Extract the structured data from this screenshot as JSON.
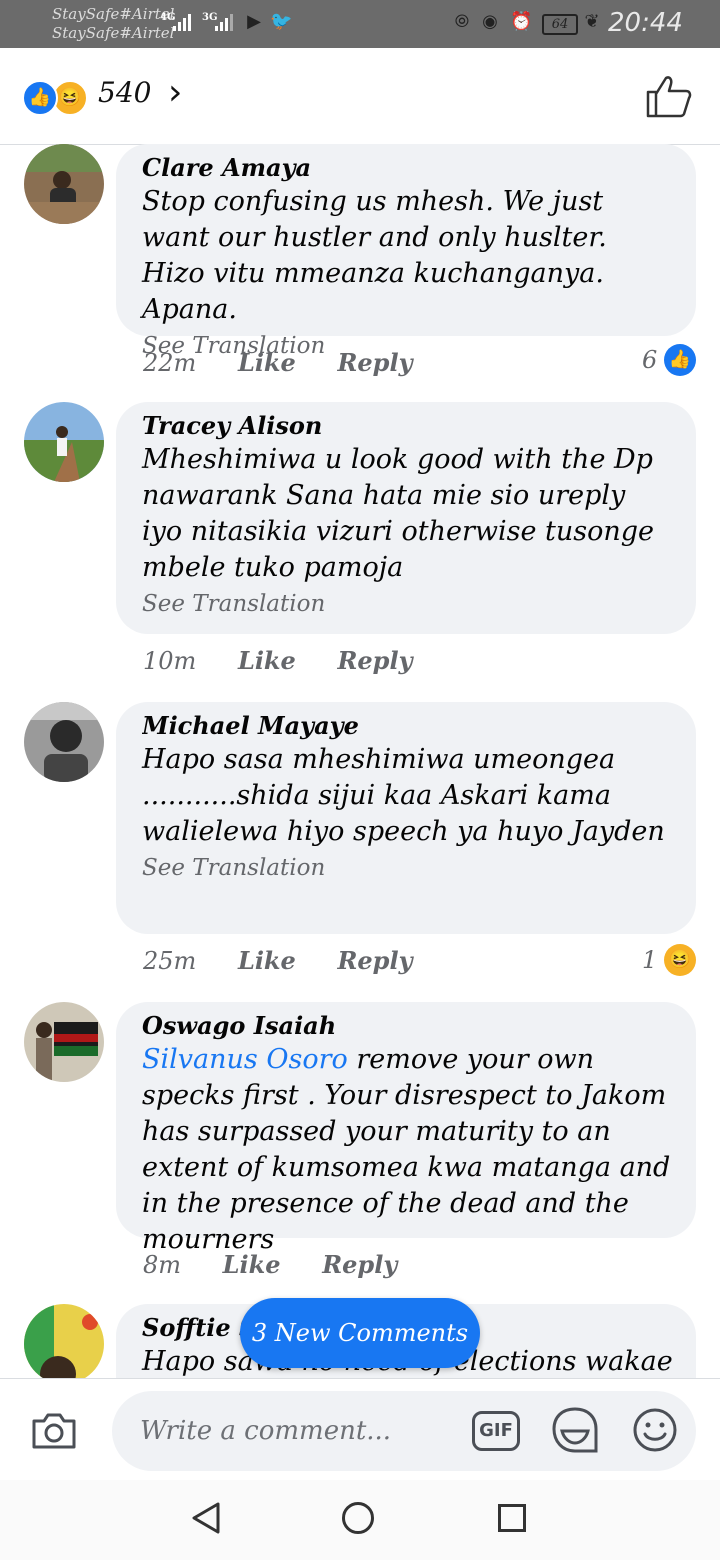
{
  "status_bar": {
    "carrier_1": "StaySafe#Airtel",
    "carrier_2": "StaySafe#Airtel",
    "network_1": "4G",
    "network_2": "3G",
    "battery": "64",
    "time": "20:44"
  },
  "header": {
    "reaction_count": "540",
    "reaction_icons": [
      "like-icon",
      "haha-icon"
    ]
  },
  "comments": [
    {
      "name": "Clare Amaya",
      "text": "Stop confusing us mhesh. We just want our hustler and only huslter. Hizo vitu mmeanza kuchanganya. Apana.",
      "translate": "See Translation",
      "time": "22m",
      "like": "Like",
      "reply": "Reply",
      "reaction_count": "6",
      "reaction_icon": "like-icon"
    },
    {
      "name": "Tracey Alison",
      "text": "Mheshimiwa u look good  with the Dp nawarank Sana hata mie sio ureply iyo nitasikia vizuri  otherwise tusonge mbele tuko pamoja",
      "translate": "See Translation",
      "time": "10m",
      "like": "Like",
      "reply": "Reply"
    },
    {
      "name": "Michael Mayaye",
      "text": "Hapo sasa mheshimiwa umeongea ...........shida sijui kaa Askari kama walielewa hiyo speech ya huyo Jayden",
      "translate": "See Translation",
      "time": "25m",
      "like": "Like",
      "reply": "Reply",
      "reaction_count": "1",
      "reaction_icon": "haha-icon"
    },
    {
      "name": "Oswago Isaiah",
      "mention": "Silvanus Osoro",
      "text": " remove your own specks first . Your disrespect to Jakom has surpassed your maturity to an extent of kumsomea kwa matanga and in the presence of the dead and the mourners",
      "time": "8m",
      "like": "Like",
      "reply": "Reply"
    },
    {
      "name": "Sofftie Sc",
      "text": "Hapo sawa no need of elections wakae"
    }
  ],
  "new_comments_button": "3 New Comments",
  "composer": {
    "placeholder": "Write a comment...",
    "gif_label": "GIF"
  },
  "colors": {
    "accent": "#1877f2",
    "bubble": "#f0f2f5",
    "meta_text": "#65676b"
  }
}
